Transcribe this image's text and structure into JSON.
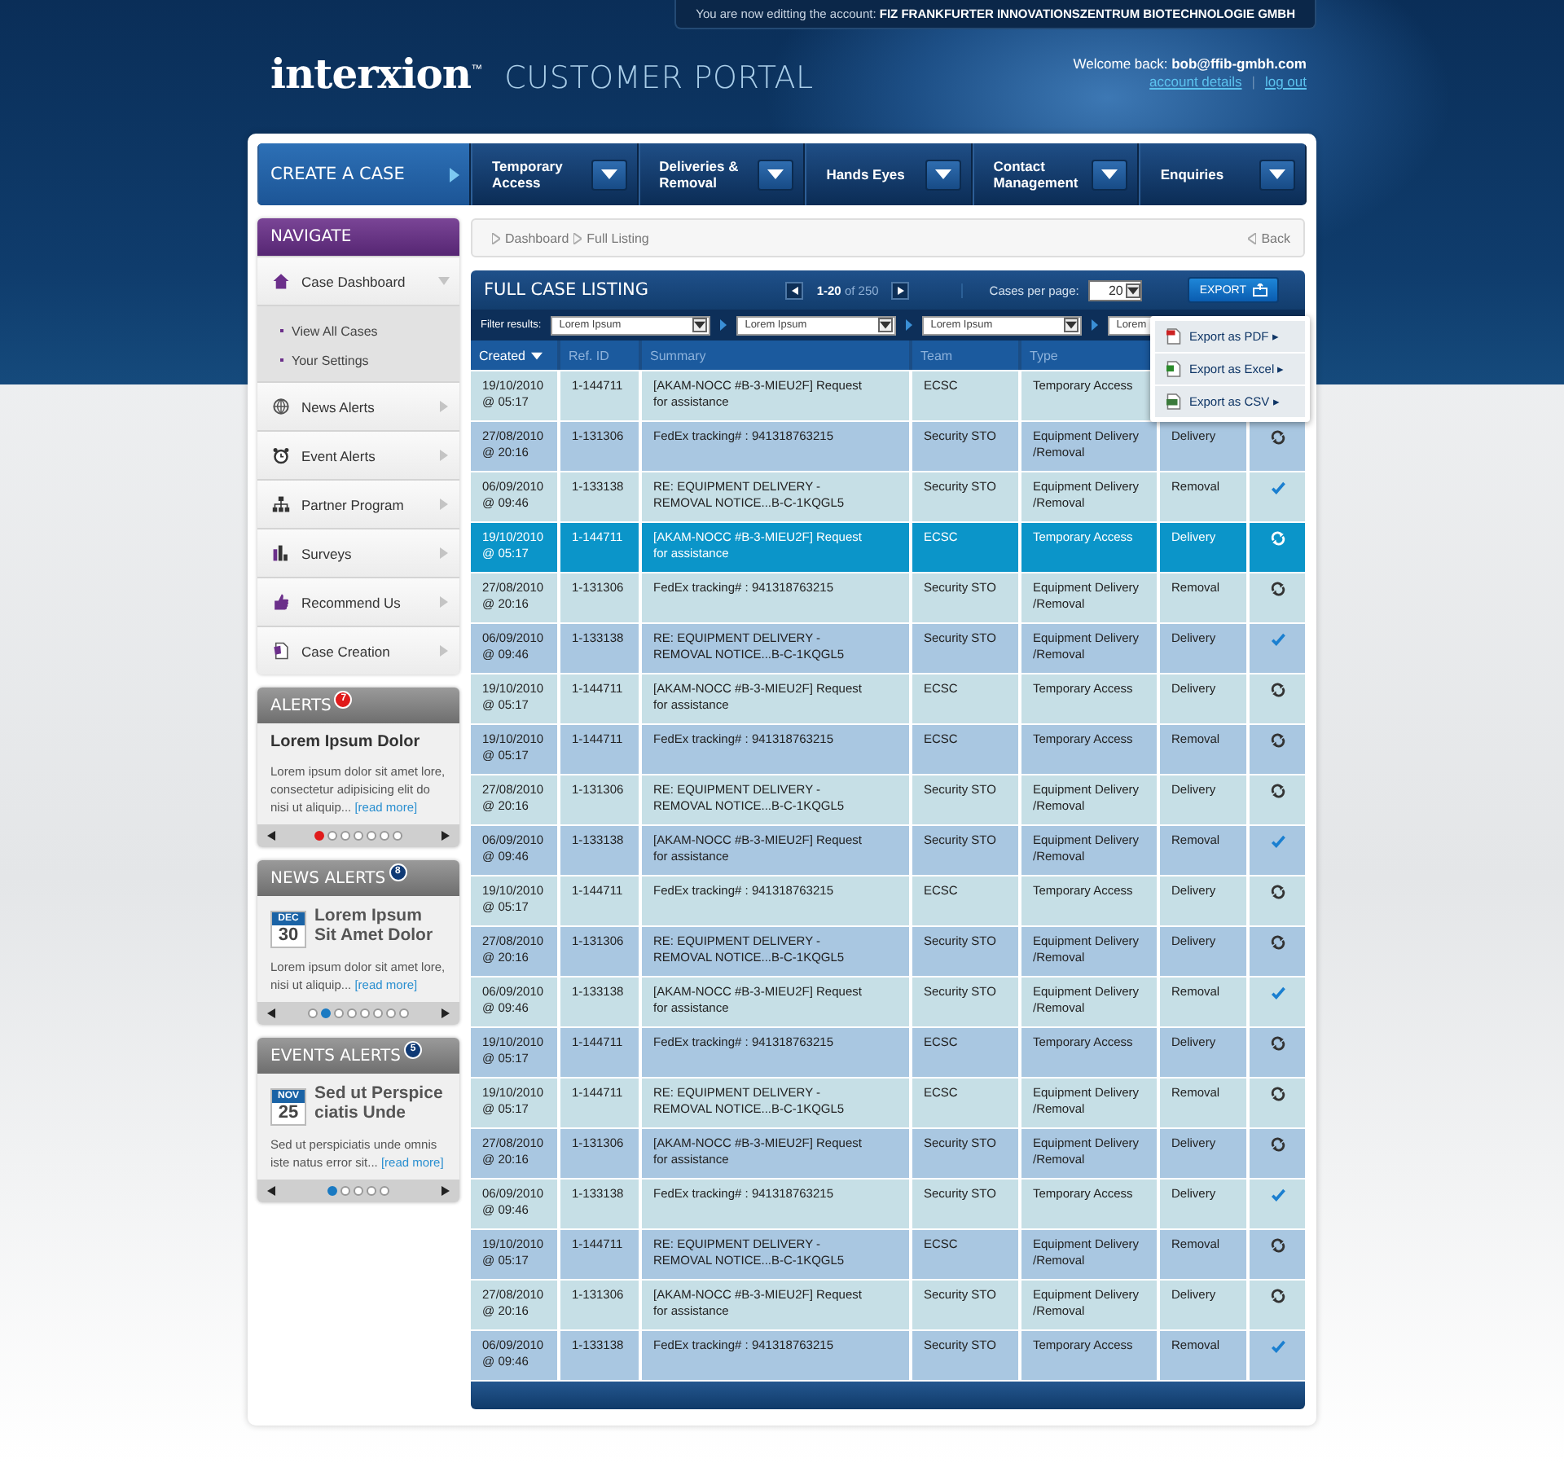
{
  "account_bar": {
    "text": "You are now editting the account: **FIZ FRANKFURTER INNOVATIONSZENTRUM BIOTECHNOLOGIE GMBH**"
  },
  "logo": {
    "brand": "interxion$^{™}$",
    "title": "CUSTOMER PORTAL"
  },
  "user": {
    "welcome": "Welcome back: **bob@ffib-gmbh.com**",
    "links": [
      "account details",
      "log out"
    ],
    "separator": "|"
  },
  "nav": [
    {
      "label": "CREATE A CASE",
      "kind": "action"
    },
    {
      "label": "Temporary Access",
      "kind": "menu"
    },
    {
      "label": "Deliveries & Removal",
      "kind": "menu"
    },
    {
      "label": "Hands Eyes",
      "kind": "menu"
    },
    {
      "label": "Contact Management",
      "kind": "menu"
    },
    {
      "label": "Enquiries",
      "kind": "menu"
    }
  ],
  "sidebar": {
    "title": "NAVIGATE",
    "items": [
      {
        "label": "Case Dashboard",
        "kind": "house",
        "expanded": true,
        "children": [
          {
            "label": "View All Cases"
          },
          {
            "label": "Your Settings"
          }
        ]
      },
      {
        "label": "News Alerts",
        "kind": "globe",
        "expanded": false
      },
      {
        "label": "Event Alerts",
        "kind": "clock",
        "expanded": false
      },
      {
        "label": "Partner Program",
        "kind": "org",
        "expanded": false
      },
      {
        "label": "Surveys",
        "kind": "bars",
        "expanded": false
      },
      {
        "label": "Recommend Us",
        "kind": "thumb",
        "expanded": false
      },
      {
        "label": "Case Creation",
        "kind": "doc",
        "expanded": false
      }
    ]
  },
  "widgets": [
    {
      "kind": "alerts",
      "title": "ALERTS",
      "count": "7",
      "heading": "Lorem Ipsum Dolor",
      "body": "Lorem ipsum dolor sit amet lore, consectetur adipisicing elit do nisi ut aliquip...",
      "link": "[read more]",
      "dots": [
        {
          "selected": true
        },
        {
          "selected": false
        },
        {
          "selected": false
        },
        {
          "selected": false
        },
        {
          "selected": false
        },
        {
          "selected": false
        },
        {
          "selected": false
        }
      ]
    },
    {
      "kind": "news",
      "title": "NEWS ALERTS",
      "count": "8",
      "month": "DEC",
      "day": "30",
      "heading": "Lorem Ipsum Sit Amet Dolor",
      "body": "Lorem ipsum dolor sit amet lore, nisi ut aliquip...",
      "link": "[read more]",
      "dots": [
        {
          "selected": false
        },
        {
          "selected": true
        },
        {
          "selected": false
        },
        {
          "selected": false
        },
        {
          "selected": false
        },
        {
          "selected": false
        },
        {
          "selected": false
        },
        {
          "selected": false
        }
      ]
    },
    {
      "kind": "events",
      "title": "EVENTS ALERTS",
      "count": "5",
      "month": "NOV",
      "day": "25",
      "heading": "Sed ut Perspice ciatis Unde",
      "body": "Sed ut perspiciatis unde omnis iste natus error sit...",
      "link": "[read more]",
      "dots": [
        {
          "selected": true
        },
        {
          "selected": false
        },
        {
          "selected": false
        },
        {
          "selected": false
        },
        {
          "selected": false
        }
      ]
    }
  ],
  "breadcrumb": {
    "items": [
      "Dashboard",
      "Full Listing"
    ],
    "back": "Back"
  },
  "listing": {
    "title": "FULL CASE LISTING",
    "range": "**1-20** of 250",
    "per_page_label": "Cases per page:",
    "per_page": "20",
    "export": "EXPORT",
    "filter_label": "Filter results:",
    "filters": [
      "Lorem Ipsum",
      "Lorem Ipsum",
      "Lorem Ipsum",
      "Lorem"
    ],
    "export_menu": [
      {
        "label": "Export as PDF ▸",
        "kind": "pdf"
      },
      {
        "label": "Export as Excel ▸",
        "kind": "excel"
      },
      {
        "label": "Export as CSV ▸",
        "kind": "csv"
      }
    ]
  },
  "table": {
    "columns": [
      {
        "label": "Created",
        "sorted": true
      },
      {
        "label": "Ref. ID",
        "sorted": false
      },
      {
        "label": "Summary",
        "sorted": false
      },
      {
        "label": "Team",
        "sorted": false
      },
      {
        "label": "Type",
        "sorted": false
      }
    ],
    "rows": [
      {
        "created": "19/10/2010 @ 05:17",
        "ref": "1-144711",
        "summary": "[AKAM-NOCC #B-3-MIEU2F] Request for assistance",
        "team": "ECSC",
        "type": "Temporary Access",
        "selected": false
      },
      {
        "created": "27/08/2010 @ 20:16",
        "ref": "1-131306",
        "summary": "FedEx tracking# : 941318763215",
        "team": "Security STO",
        "type": "Equipment Delivery /Removal",
        "column_6": "Delivery",
        "status": {
          "kind": "refresh"
        },
        "selected": false
      },
      {
        "created": "06/09/2010 @ 09:46",
        "ref": "1-133138",
        "summary": "RE: EQUIPMENT DELIVERY - REMOVAL NOTICE...B-C-1KQGL5",
        "team": "Security STO",
        "type": "Equipment Delivery /Removal",
        "column_6": "Removal",
        "status": {
          "kind": "check"
        },
        "selected": false
      },
      {
        "created": "19/10/2010 @ 05:17",
        "ref": "1-144711",
        "summary": "[AKAM-NOCC #B-3-MIEU2F] Request for assistance",
        "team": "ECSC",
        "type": "Temporary Access",
        "column_6": "Delivery",
        "status": {
          "kind": "refresh"
        },
        "selected": true
      },
      {
        "created": "27/08/2010 @ 20:16",
        "ref": "1-131306",
        "summary": "FedEx tracking# : 941318763215",
        "team": "Security STO",
        "type": "Equipment Delivery /Removal",
        "column_6": "Removal",
        "status": {
          "kind": "refresh"
        },
        "selected": false
      },
      {
        "created": "06/09/2010 @ 09:46",
        "ref": "1-133138",
        "summary": "RE: EQUIPMENT DELIVERY - REMOVAL NOTICE...B-C-1KQGL5",
        "team": "Security STO",
        "type": "Equipment Delivery /Removal",
        "column_6": "Delivery",
        "status": {
          "kind": "check"
        },
        "selected": false
      },
      {
        "created": "19/10/2010 @ 05:17",
        "ref": "1-144711",
        "summary": "[AKAM-NOCC #B-3-MIEU2F] Request for assistance",
        "team": "ECSC",
        "type": "Temporary Access",
        "column_6": "Delivery",
        "status": {
          "kind": "refresh"
        },
        "selected": false
      },
      {
        "created": "19/10/2010 @ 05:17",
        "ref": "1-144711",
        "summary": "FedEx tracking# : 941318763215",
        "team": "ECSC",
        "type": "Temporary Access",
        "column_6": "Removal",
        "status": {
          "kind": "refresh"
        },
        "selected": false
      },
      {
        "created": "27/08/2010 @ 20:16",
        "ref": "1-131306",
        "summary": "RE: EQUIPMENT DELIVERY - REMOVAL NOTICE...B-C-1KQGL5",
        "team": "Security STO",
        "type": "Equipment Delivery /Removal",
        "column_6": "Delivery",
        "status": {
          "kind": "refresh"
        },
        "selected": false
      },
      {
        "created": "06/09/2010 @ 09:46",
        "ref": "1-133138",
        "summary": "[AKAM-NOCC #B-3-MIEU2F] Request for assistance",
        "team": "Security STO",
        "type": "Equipment Delivery /Removal",
        "column_6": "Removal",
        "status": {
          "kind": "check"
        },
        "selected": false
      },
      {
        "created": "19/10/2010 @ 05:17",
        "ref": "1-144711",
        "summary": "FedEx tracking# : 941318763215",
        "team": "ECSC",
        "type": "Temporary Access",
        "column_6": "Delivery",
        "status": {
          "kind": "refresh"
        },
        "selected": false
      },
      {
        "created": "27/08/2010 @ 20:16",
        "ref": "1-131306",
        "summary": "RE: EQUIPMENT DELIVERY - REMOVAL NOTICE...B-C-1KQGL5",
        "team": "Security STO",
        "type": "Equipment Delivery /Removal",
        "column_6": "Delivery",
        "status": {
          "kind": "refresh"
        },
        "selected": false
      },
      {
        "created": "06/09/2010 @ 09:46",
        "ref": "1-133138",
        "summary": "[AKAM-NOCC #B-3-MIEU2F] Request for assistance",
        "team": "Security STO",
        "type": "Equipment Delivery /Removal",
        "column_6": "Removal",
        "status": {
          "kind": "check"
        },
        "selected": false
      },
      {
        "created": "19/10/2010 @ 05:17",
        "ref": "1-144711",
        "summary": "FedEx tracking# : 941318763215",
        "team": "ECSC",
        "type": "Temporary Access",
        "column_6": "Delivery",
        "status": {
          "kind": "refresh"
        },
        "selected": false
      },
      {
        "created": "19/10/2010 @ 05:17",
        "ref": "1-144711",
        "summary": "RE: EQUIPMENT DELIVERY - REMOVAL NOTICE...B-C-1KQGL5",
        "team": "ECSC",
        "type": "Equipment Delivery /Removal",
        "column_6": "Removal",
        "status": {
          "kind": "refresh"
        },
        "selected": false
      },
      {
        "created": "27/08/2010 @ 20:16",
        "ref": "1-131306",
        "summary": "[AKAM-NOCC #B-3-MIEU2F] Request for assistance",
        "team": "Security STO",
        "type": "Equipment Delivery /Removal",
        "column_6": "Delivery",
        "status": {
          "kind": "refresh"
        },
        "selected": false
      },
      {
        "created": "06/09/2010 @ 09:46",
        "ref": "1-133138",
        "summary": "FedEx tracking# : 941318763215",
        "team": "Security STO",
        "type": "Temporary Access",
        "column_6": "Delivery",
        "status": {
          "kind": "check"
        },
        "selected": false
      },
      {
        "created": "19/10/2010 @ 05:17",
        "ref": "1-144711",
        "summary": "RE: EQUIPMENT DELIVERY - REMOVAL NOTICE...B-C-1KQGL5",
        "team": "ECSC",
        "type": "Equipment Delivery /Removal",
        "column_6": "Removal",
        "status": {
          "kind": "refresh"
        },
        "selected": false
      },
      {
        "created": "27/08/2010 @ 20:16",
        "ref": "1-131306",
        "summary": "[AKAM-NOCC #B-3-MIEU2F] Request for assistance",
        "team": "Security STO",
        "type": "Equipment Delivery /Removal",
        "column_6": "Delivery",
        "status": {
          "kind": "refresh"
        },
        "selected": false
      },
      {
        "created": "06/09/2010 @ 09:46",
        "ref": "1-133138",
        "summary": "FedEx tracking# : 941318763215",
        "team": "Security STO",
        "type": "Temporary Access",
        "column_6": "Removal",
        "status": {
          "kind": "check"
        },
        "selected": false
      }
    ]
  }
}
